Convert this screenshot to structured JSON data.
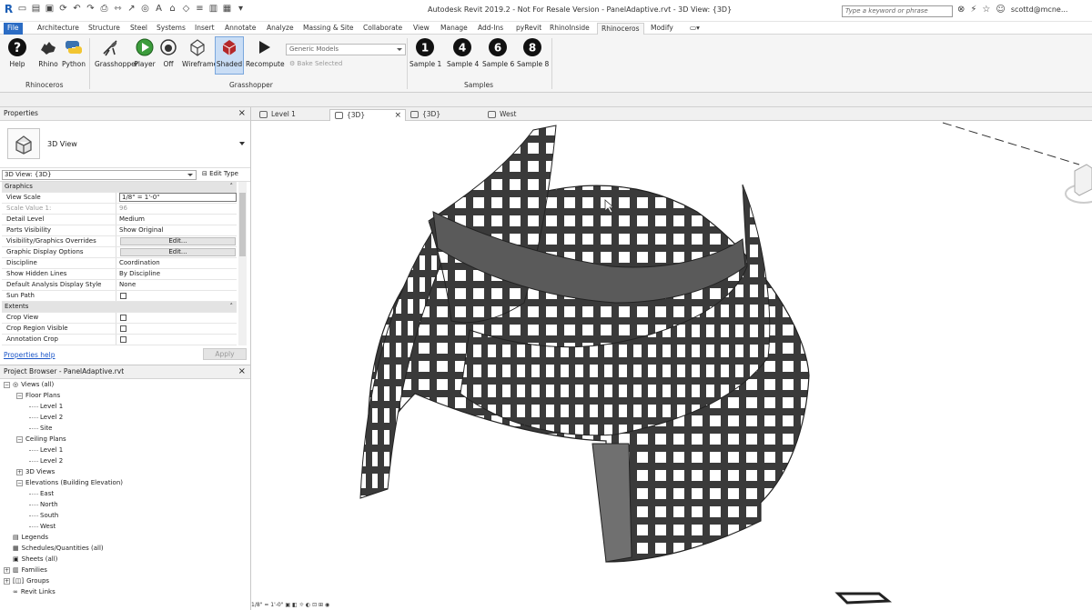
{
  "app": {
    "title": "Autodesk Revit 2019.2 - Not For Resale Version - PanelAdaptive.rvt - 3D View: {3D}",
    "logo": "R",
    "search_placeholder": "Type a keyword or phrase",
    "user": "scottd@mcne..."
  },
  "ribbon_tabs": [
    {
      "label": "File"
    },
    {
      "label": "Architecture"
    },
    {
      "label": "Structure"
    },
    {
      "label": "Steel"
    },
    {
      "label": "Systems"
    },
    {
      "label": "Insert"
    },
    {
      "label": "Annotate"
    },
    {
      "label": "Analyze"
    },
    {
      "label": "Massing & Site"
    },
    {
      "label": "Collaborate"
    },
    {
      "label": "View"
    },
    {
      "label": "Manage"
    },
    {
      "label": "Add-Ins"
    },
    {
      "label": "pyRevit"
    },
    {
      "label": "RhinoInside"
    },
    {
      "label": "Rhinoceros"
    },
    {
      "label": "Modify"
    }
  ],
  "ribbon": {
    "buttons": [
      {
        "label": "Help",
        "icon": "help-icon"
      },
      {
        "label": "Rhino",
        "icon": "rhino-icon"
      },
      {
        "label": "Python",
        "icon": "python-icon"
      },
      {
        "label": "Grasshopper",
        "icon": "grasshopper-icon"
      },
      {
        "label": "Player",
        "icon": "player-icon"
      },
      {
        "label": "Off",
        "icon": "preview-off-icon"
      },
      {
        "label": "Wireframe",
        "icon": "wireframe-icon"
      },
      {
        "label": "Shaded",
        "icon": "shaded-icon"
      },
      {
        "label": "Recompute",
        "icon": "recompute-icon"
      }
    ],
    "category_combo": "Generic Models",
    "bake_label": "Bake Selected",
    "samples": [
      {
        "label": "Sample 1",
        "num": "1"
      },
      {
        "label": "Sample 4",
        "num": "4"
      },
      {
        "label": "Sample 6",
        "num": "6"
      },
      {
        "label": "Sample 8",
        "num": "8"
      }
    ],
    "panels": {
      "rhinoceros": "Rhinoceros",
      "grasshopper": "Grasshopper",
      "samples": "Samples"
    }
  },
  "properties": {
    "title": "Properties",
    "type_name": "3D View",
    "view_selector": "3D View: {3D}",
    "edit_type": "Edit Type",
    "rows": [
      {
        "k": "Graphics",
        "v": "",
        "kind": "section"
      },
      {
        "k": "View Scale",
        "v": "1/8\" = 1'-0\"",
        "kind": "input"
      },
      {
        "k": "Scale Value    1:",
        "v": "96",
        "kind": "disabled"
      },
      {
        "k": "Detail Level",
        "v": "Medium",
        "kind": "text"
      },
      {
        "k": "Parts Visibility",
        "v": "Show Original",
        "kind": "text"
      },
      {
        "k": "Visibility/Graphics Overrides",
        "v": "Edit...",
        "kind": "button"
      },
      {
        "k": "Graphic Display Options",
        "v": "Edit...",
        "kind": "button"
      },
      {
        "k": "Discipline",
        "v": "Coordination",
        "kind": "text"
      },
      {
        "k": "Show Hidden Lines",
        "v": "By Discipline",
        "kind": "text"
      },
      {
        "k": "Default Analysis Display Style",
        "v": "None",
        "kind": "text"
      },
      {
        "k": "Sun Path",
        "v": "",
        "kind": "check"
      },
      {
        "k": "Extents",
        "v": "",
        "kind": "section"
      },
      {
        "k": "Crop View",
        "v": "",
        "kind": "check"
      },
      {
        "k": "Crop Region Visible",
        "v": "",
        "kind": "check"
      },
      {
        "k": "Annotation Crop",
        "v": "",
        "kind": "check"
      }
    ],
    "help_link": "Properties help",
    "apply": "Apply"
  },
  "browser": {
    "title": "Project Browser - PanelAdaptive.rvt",
    "nodes": [
      {
        "label": "Views (all)",
        "level": 0,
        "exp": "-",
        "icon": "views-icon"
      },
      {
        "label": "Floor Plans",
        "level": 1,
        "exp": "-"
      },
      {
        "label": "Level 1",
        "level": 2
      },
      {
        "label": "Level 2",
        "level": 2
      },
      {
        "label": "Site",
        "level": 2
      },
      {
        "label": "Ceiling Plans",
        "level": 1,
        "exp": "-"
      },
      {
        "label": "Level 1",
        "level": 2
      },
      {
        "label": "Level 2",
        "level": 2
      },
      {
        "label": "3D Views",
        "level": 1,
        "exp": "+"
      },
      {
        "label": "Elevations (Building Elevation)",
        "level": 1,
        "exp": "-"
      },
      {
        "label": "East",
        "level": 2
      },
      {
        "label": "North",
        "level": 2
      },
      {
        "label": "South",
        "level": 2
      },
      {
        "label": "West",
        "level": 2
      },
      {
        "label": "Legends",
        "level": 0,
        "exp": "",
        "icon": "legends-icon"
      },
      {
        "label": "Schedules/Quantities (all)",
        "level": 0,
        "exp": "",
        "icon": "schedules-icon"
      },
      {
        "label": "Sheets (all)",
        "level": 0,
        "exp": "",
        "icon": "sheets-icon"
      },
      {
        "label": "Families",
        "level": 0,
        "exp": "+",
        "icon": "families-icon"
      },
      {
        "label": "Groups",
        "level": 0,
        "exp": "+",
        "icon": "groups-icon"
      },
      {
        "label": "Revit Links",
        "level": 0,
        "exp": "",
        "icon": "links-icon"
      }
    ]
  },
  "doc_tabs": [
    {
      "label": "Level 1",
      "active": false,
      "icon": "plan-icon"
    },
    {
      "label": "{3D}",
      "active": true,
      "icon": "3d-view-icon"
    },
    {
      "label": "{3D}",
      "active": false,
      "icon": "3d-view-icon"
    },
    {
      "label": "West",
      "active": false,
      "icon": "elevation-icon"
    }
  ],
  "viewport": {
    "scale_readout": "1/8\" = 1'-0\""
  }
}
